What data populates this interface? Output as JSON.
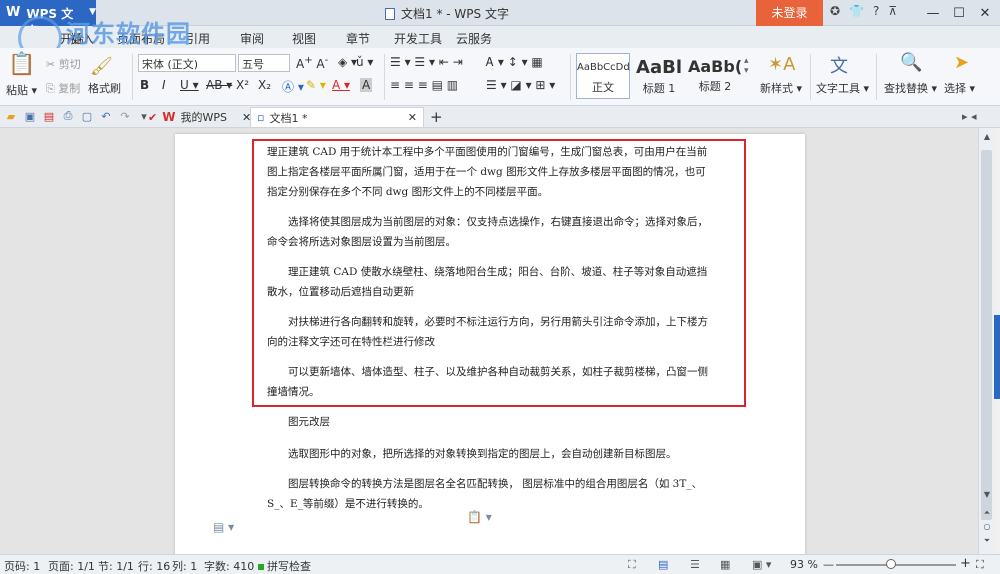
{
  "titlebar": {
    "app_name": "WPS 文字",
    "title": "文档1 * - WPS 文字",
    "login": "未登录",
    "help": "?"
  },
  "watermark": {
    "text": "河东软件园",
    "url": "www.pc0359.cn"
  },
  "menu": {
    "items": [
      "开始",
      "插入",
      "页面布局",
      "引用",
      "审阅",
      "视图",
      "章节",
      "开发工具",
      "云服务"
    ]
  },
  "ribbon": {
    "paste": "粘贴",
    "cut": "剪切",
    "copy": "复制",
    "format_painter": "格式刷",
    "font_name": "宋体 (正文)",
    "font_size": "五号",
    "styles": [
      {
        "preview": "AaBbCcDd",
        "label": "正文"
      },
      {
        "preview": "AaBl",
        "label": "标题 1"
      },
      {
        "preview": "AaBb(",
        "label": "标题 2"
      }
    ],
    "new_style": "新样式",
    "text_tools": "文字工具",
    "find_replace": "查找替换",
    "select": "选择"
  },
  "tabs": {
    "wps_home": "我的WPS",
    "doc": "文档1 *"
  },
  "document": {
    "paragraphs": [
      "理正建筑 CAD 用于统计本工程中多个平面图使用的门窗编号，生成门窗总表，可由用户在当前图上指定各楼层平面所属门窗，适用于在一个 dwg 图形文件上存放多楼层平面图的情况，也可指定分别保存在多个不同 dwg 图形文件上的不同楼层平面。",
      "选择将使其图层成为当前图层的对象：仅支持点选操作，右键直接退出命令；选择对象后，命令会将所选对象图层设置为当前图层。",
      "理正建筑 CAD 使散水绕壁柱、绕落地阳台生成；阳台、台阶、坡道、柱子等对象自动遮挡散水，位置移动后遮挡自动更新",
      "对扶梯进行各向翻转和旋转，必要时不标注运行方向，另行用箭头引注命令添加，上下楼方向的注释文字还可在特性栏进行修改",
      "可以更新墙体、墙体造型、柱子、以及维护各种自动裁剪关系，如柱子裁剪楼梯，凸窗一侧撞墙情况。",
      "图元改层",
      "选取图形中的对象，把所选择的对象转换到指定的图层上，会自动创建新目标图层。",
      "图层转换命令的转换方法是图层名全名匹配转换， 图层标准中的组合用图层名（如 3T_、S_、E_等前缀）是不进行转换的。"
    ]
  },
  "status": {
    "page_num": "页码: 1",
    "pages": "页面: 1/1",
    "section": "节: 1/1",
    "row": "行: 16",
    "col": "列: 1",
    "words": "字数: 410",
    "spell": "拼写检查",
    "zoom": "93 %"
  }
}
